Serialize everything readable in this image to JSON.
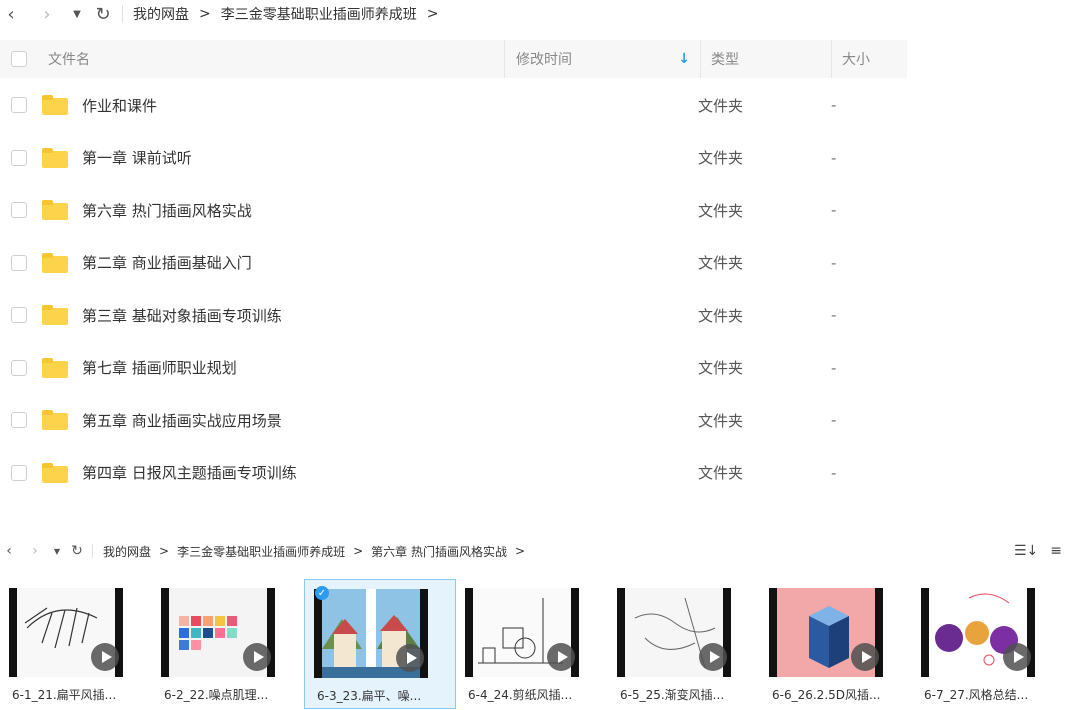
{
  "top": {
    "breadcrumb": [
      "我的网盘",
      "李三金零基础职业插画师养成班"
    ],
    "columns": {
      "name": "文件名",
      "modified": "修改时间",
      "type": "类型",
      "size": "大小"
    },
    "rows": [
      {
        "name": "作业和课件",
        "type": "文件夹",
        "size": "-"
      },
      {
        "name": "第一章 课前试听",
        "type": "文件夹",
        "size": "-"
      },
      {
        "name": "第六章 热门插画风格实战",
        "type": "文件夹",
        "size": "-"
      },
      {
        "name": "第二章 商业插画基础入门",
        "type": "文件夹",
        "size": "-"
      },
      {
        "name": "第三章 基础对象插画专项训练",
        "type": "文件夹",
        "size": "-"
      },
      {
        "name": "第七章 插画师职业规划",
        "type": "文件夹",
        "size": "-"
      },
      {
        "name": "第五章 商业插画实战应用场景",
        "type": "文件夹",
        "size": "-"
      },
      {
        "name": "第四章 日报风主题插画专项训练",
        "type": "文件夹",
        "size": "-"
      }
    ]
  },
  "bottom": {
    "breadcrumb": [
      "我的网盘",
      "李三金零基础职业插画师养成班",
      "第六章 热门插画风格实战"
    ],
    "videos": [
      {
        "label": "6-1_21.扁平风插..."
      },
      {
        "label": "6-2_22.噪点肌理..."
      },
      {
        "label": "6-3_23.扁平、噪..."
      },
      {
        "label": "6-4_24.剪纸风插..."
      },
      {
        "label": "6-5_25.渐变风插..."
      },
      {
        "label": "6-6_26.2.5D风插..."
      },
      {
        "label": "6-7_27.风格总结..."
      }
    ]
  },
  "colors": {
    "folder": "#fcd34a",
    "accent": "#2e9bf0",
    "selected_bg": "#e5f3fd"
  }
}
